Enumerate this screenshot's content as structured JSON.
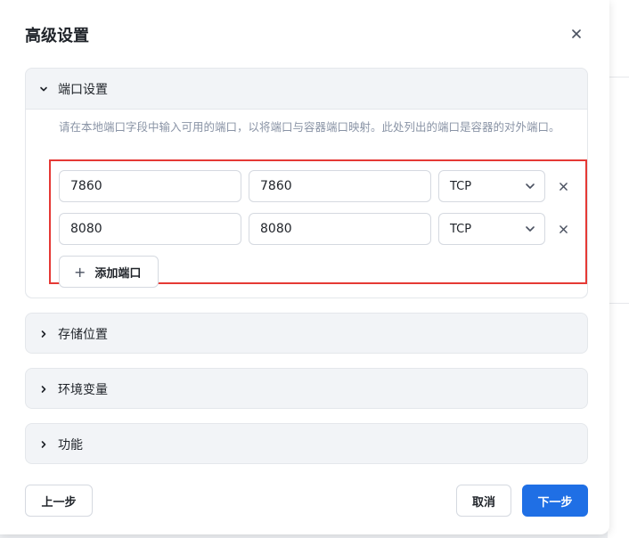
{
  "dialog": {
    "title": "高级设置",
    "close_icon": "close-icon"
  },
  "sections": {
    "ports": {
      "label": "端口设置",
      "expanded": true,
      "description": "请在本地端口字段中输入可用的端口，以将端口与容器端口映射。此处列出的端口是容器的对外端口。",
      "rows": [
        {
          "local_port": "7860",
          "container_port": "7860",
          "protocol": "TCP"
        },
        {
          "local_port": "8080",
          "container_port": "8080",
          "protocol": "TCP"
        }
      ],
      "add_label": "添加端口",
      "add_icon": "plus-icon"
    },
    "storage": {
      "label": "存储位置",
      "expanded": false
    },
    "env": {
      "label": "环境变量",
      "expanded": false
    },
    "features": {
      "label": "功能",
      "expanded": false
    }
  },
  "footer": {
    "prev_label": "上一步",
    "cancel_label": "取消",
    "next_label": "下一步"
  },
  "colors": {
    "primary": "#1f6fe5",
    "highlight": "#e53935"
  }
}
